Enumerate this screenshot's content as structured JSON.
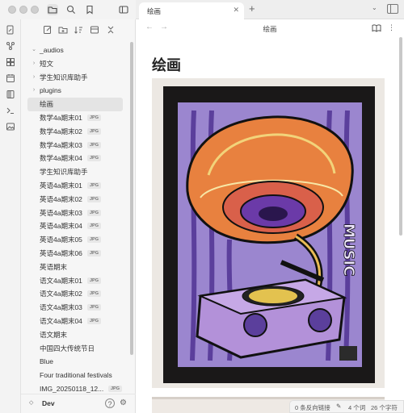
{
  "sidebar": {
    "items": [
      {
        "type": "folder",
        "label": "_audios",
        "expanded": true,
        "badge": ""
      },
      {
        "type": "folder",
        "label": "短文",
        "expanded": false,
        "badge": ""
      },
      {
        "type": "folder",
        "label": "学生知识库助手",
        "expanded": false,
        "badge": ""
      },
      {
        "type": "folder",
        "label": "plugins",
        "expanded": false,
        "badge": ""
      },
      {
        "type": "file",
        "label": "绘画",
        "active": true,
        "badge": ""
      },
      {
        "type": "file",
        "label": "数学4a期末01",
        "badge": "JPG"
      },
      {
        "type": "file",
        "label": "数学4a期末02",
        "badge": "JPG"
      },
      {
        "type": "file",
        "label": "数学4a期末03",
        "badge": "JPG"
      },
      {
        "type": "file",
        "label": "数学4a期末04",
        "badge": "JPG"
      },
      {
        "type": "file",
        "label": "学生知识库助手",
        "badge": ""
      },
      {
        "type": "file",
        "label": "英语4a期末01",
        "badge": "JPG"
      },
      {
        "type": "file",
        "label": "英语4a期末02",
        "badge": "JPG"
      },
      {
        "type": "file",
        "label": "英语4a期末03",
        "badge": "JPG"
      },
      {
        "type": "file",
        "label": "英语4a期末04",
        "badge": "JPG"
      },
      {
        "type": "file",
        "label": "英语4a期末05",
        "badge": "JPG"
      },
      {
        "type": "file",
        "label": "英语4a期末06",
        "badge": "JPG"
      },
      {
        "type": "file",
        "label": "英语期末",
        "badge": ""
      },
      {
        "type": "file",
        "label": "语文4a期末01",
        "badge": "JPG"
      },
      {
        "type": "file",
        "label": "语文4a期末02",
        "badge": "JPG"
      },
      {
        "type": "file",
        "label": "语文4a期末03",
        "badge": "JPG"
      },
      {
        "type": "file",
        "label": "语文4a期末04",
        "badge": "JPG"
      },
      {
        "type": "file",
        "label": "语文期末",
        "badge": ""
      },
      {
        "type": "file",
        "label": "中国四大传统节日",
        "badge": ""
      },
      {
        "type": "file",
        "label": "Blue",
        "badge": ""
      },
      {
        "type": "file",
        "label": "Four traditional festivals",
        "badge": ""
      },
      {
        "type": "file",
        "label": "IMG_20250118_12...",
        "badge": "JPG"
      }
    ],
    "vault_name": "Dev"
  },
  "tab": {
    "title": "绘画",
    "close": "✕",
    "add": "+"
  },
  "view": {
    "title": "绘画",
    "back": "←",
    "forward": "→"
  },
  "note": {
    "title": "绘画",
    "artwork_text": "MUSIC"
  },
  "status": {
    "backlinks": "0 条反向链接",
    "words": "4 个词",
    "chars": "26 个字符"
  },
  "colors": {
    "accent": "#7a5cc7",
    "sidebar_bg": "#f6f6f6",
    "content_bg": "#ffffff"
  }
}
